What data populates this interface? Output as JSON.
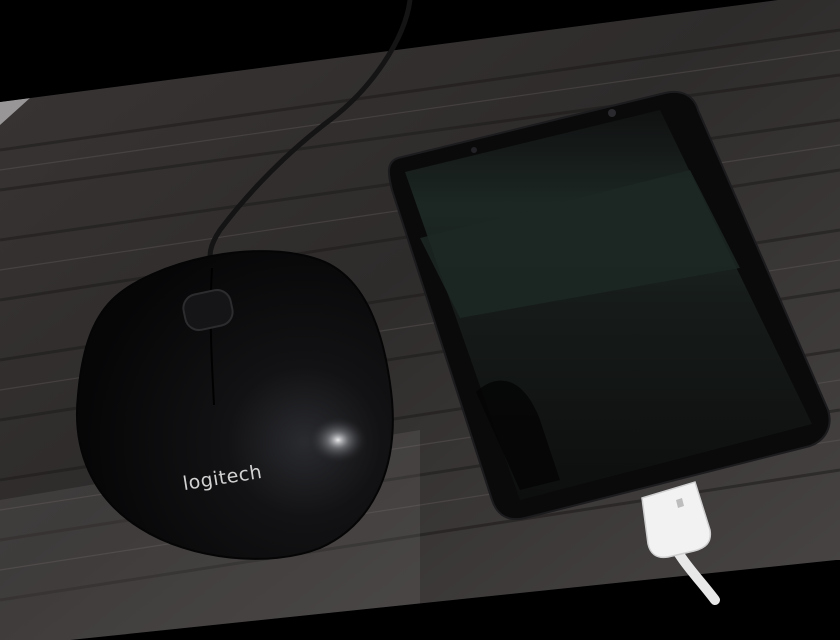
{
  "scene": {
    "background_color": "#000000",
    "desk_color": "#2e2b2b",
    "mouse_color": "#0b0b0d",
    "phone_body_color": "#0a0a0b",
    "phone_screen_color": "#141616",
    "phone_screen_band_color": "#1c2723",
    "cable_color": "#f2f2f2"
  },
  "mouse": {
    "brand_label": "logitech"
  }
}
